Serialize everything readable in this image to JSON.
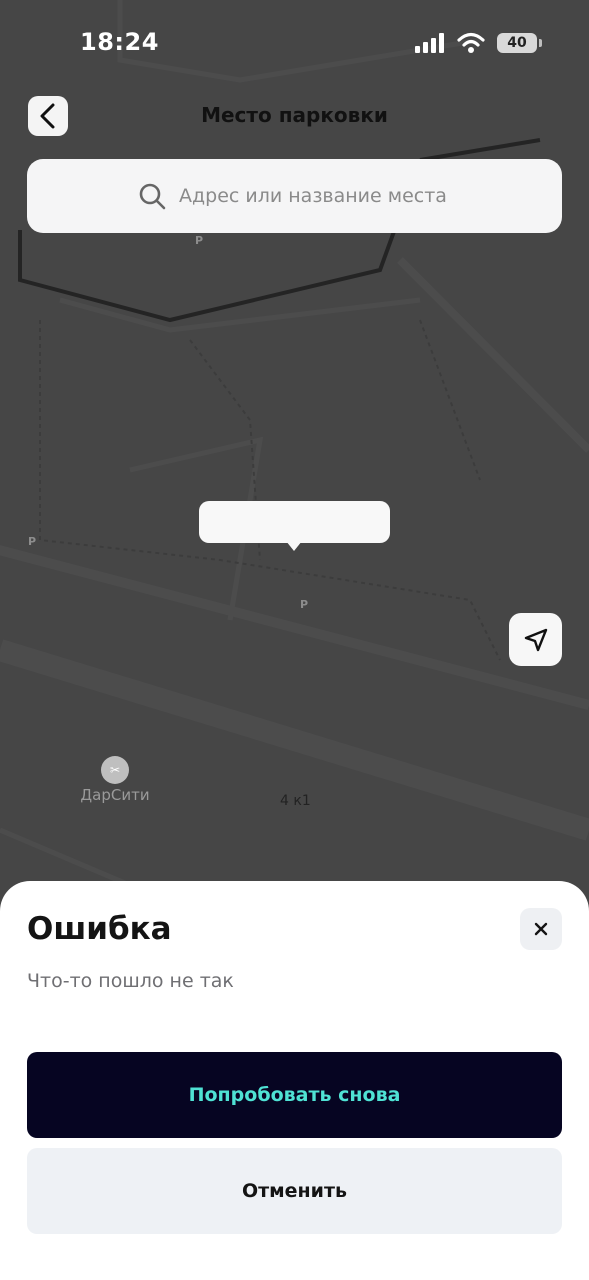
{
  "status_bar": {
    "time": "18:24",
    "battery_level": "40",
    "icons": [
      "cellular-signal-icon",
      "wifi-icon",
      "battery-icon"
    ]
  },
  "header": {
    "title": "Место парковки",
    "back_icon": "chevron-left-icon"
  },
  "search": {
    "placeholder": "Адрес или название места",
    "icon": "search-icon"
  },
  "map": {
    "poi_label": "ДарСити",
    "house_number": "4 к1",
    "parking_marker": "P",
    "locate_icon": "navigation-arrow-icon"
  },
  "error_sheet": {
    "title": "Ошибка",
    "message": "Что-то пошло не так",
    "close_icon": "close-icon",
    "retry_label": "Попробовать снова",
    "cancel_label": "Отменить",
    "colors": {
      "retry_background": "#060522",
      "retry_text": "#4fe2d4",
      "cancel_background": "#eef1f5"
    }
  }
}
